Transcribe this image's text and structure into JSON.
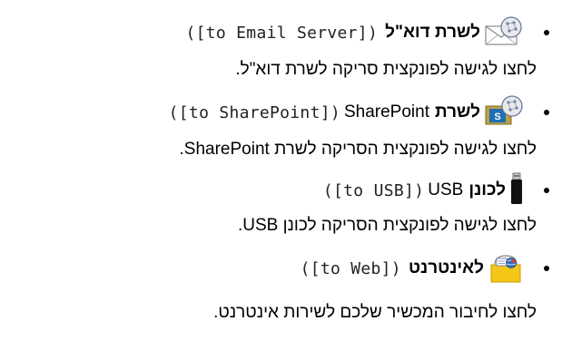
{
  "items": [
    {
      "code": "([to Email Server])",
      "title": "לשרת דוא\"ל",
      "icon": "email-scan-icon",
      "description": "לחצו לגישה לפונקצית סריקה לשרת דוא\"ל."
    },
    {
      "code": "([to SharePoint])",
      "title_latin": "SharePoint",
      "title": "לשרת",
      "icon": "sharepoint-scan-icon",
      "description": "לחצו לגישה לפונקצית הסריקה לשרת SharePoint."
    },
    {
      "code": "([to USB])",
      "title_latin": "USB",
      "title": "לכונן",
      "icon": "usb-drive-icon",
      "description": "לחצו לגישה לפונקצית הסריקה לכונן USB."
    },
    {
      "code": "([to Web])",
      "title": "לאינטרנט",
      "icon": "web-connect-icon",
      "description": "לחצו לחיבור המכשיר שלכם לשירות אינטרנט."
    }
  ]
}
